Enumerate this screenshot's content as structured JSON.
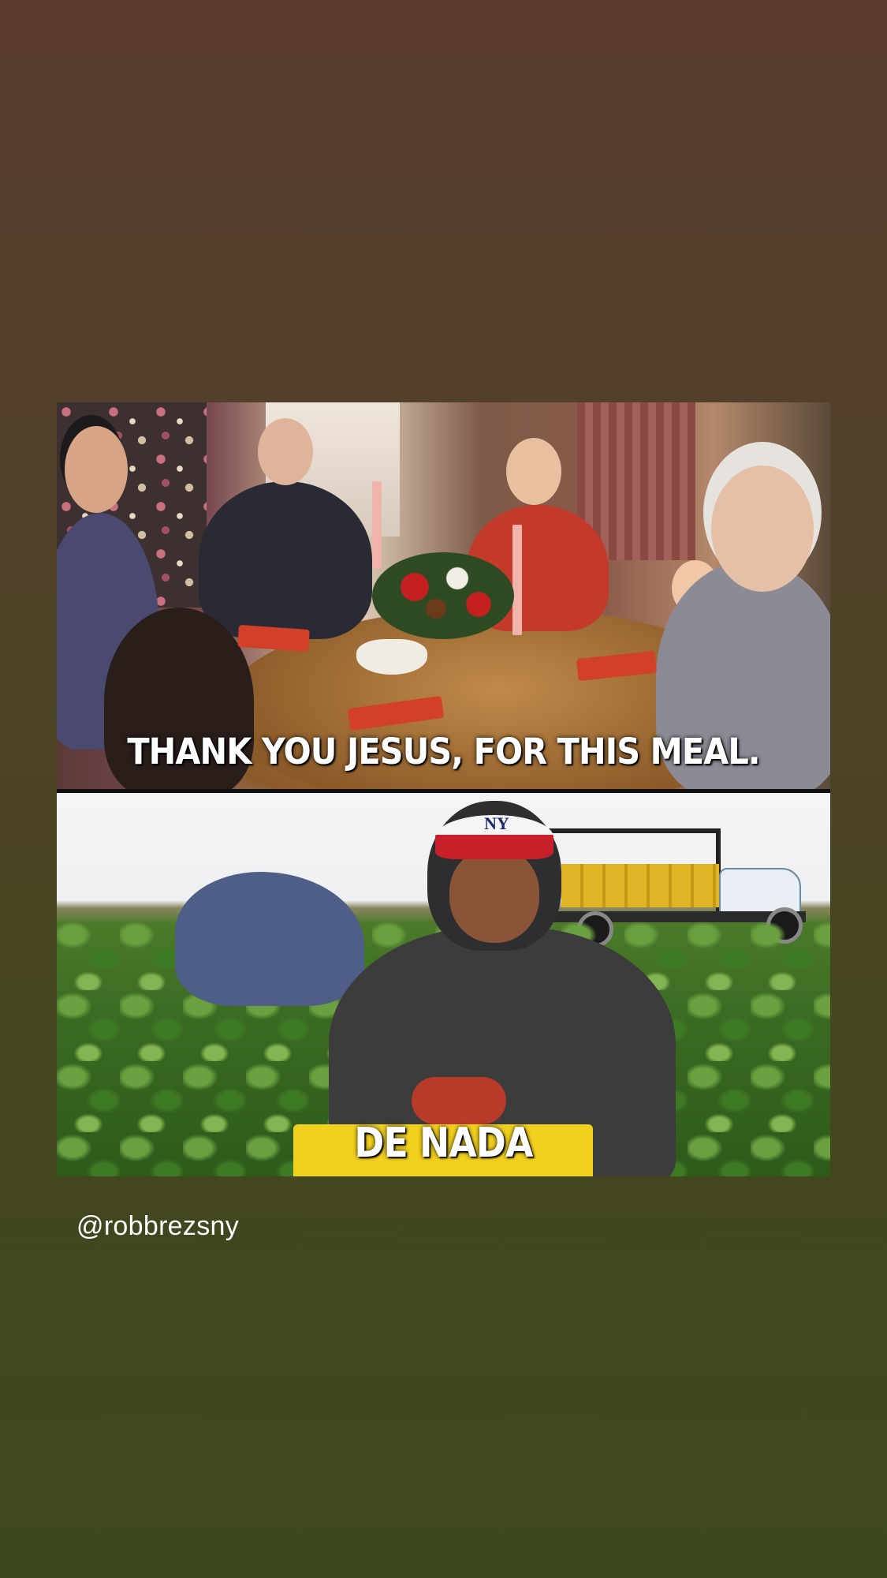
{
  "meme": {
    "top_caption": "THANK YOU JESUS, FOR THIS MEAL.",
    "bottom_caption": "DE NADA",
    "cap_logo": "NY"
  },
  "story": {
    "mention_handle": "@robbrezsny"
  },
  "colors": {
    "background_top": "#5a3c2e",
    "background_bottom": "#3e481e",
    "caption_text": "#ffffff"
  }
}
